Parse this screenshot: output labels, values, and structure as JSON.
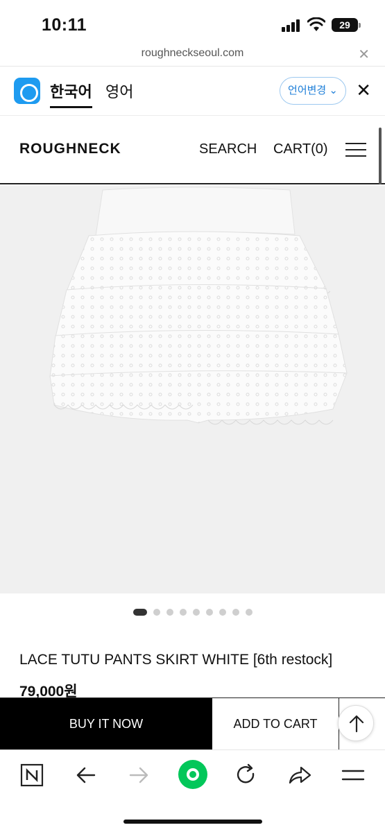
{
  "status_bar": {
    "time": "10:11",
    "battery": "29",
    "icons": [
      "signal-icon",
      "wifi-icon",
      "battery-icon"
    ]
  },
  "browser": {
    "url": "roughneckseoul.com"
  },
  "translate_bar": {
    "active_language": "한국어",
    "other_language": "영어",
    "change_language": "언어변경",
    "accent_color": "#1e9bf0"
  },
  "site_header": {
    "logo": "ROUGHNECK",
    "search": "SEARCH",
    "cart": "CART(0)"
  },
  "product": {
    "image_icon": "skirt-product-photo",
    "image_count": 9,
    "active_image_index": 0,
    "title": "LACE TUTU PANTS SKIRT WHITE [6th restock]",
    "price": "79,000원"
  },
  "actions": {
    "buy_now": "BUY IT NOW",
    "add_to_cart": "ADD TO CART"
  },
  "toolbar": {
    "icons": [
      "naver-n-icon",
      "back-arrow-icon",
      "forward-arrow-icon",
      "green-home-icon",
      "reload-icon",
      "share-icon",
      "menu-icon"
    ],
    "accent_color": "#03c75a"
  }
}
